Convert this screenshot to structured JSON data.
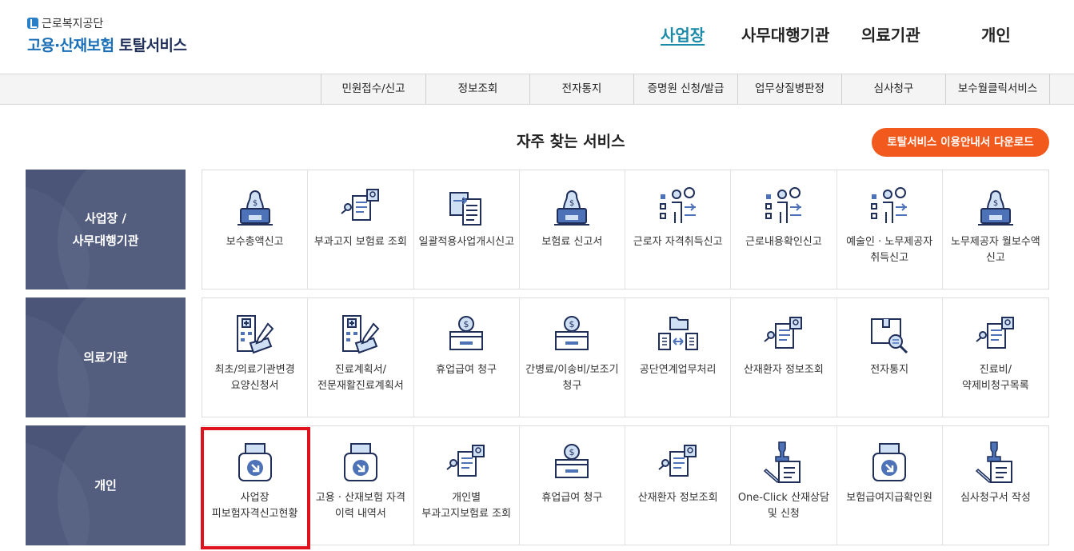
{
  "logo": {
    "org": "근로복지공단",
    "main_a": "고용·산재보험",
    "main_b": "토탈서비스"
  },
  "top_nav": [
    {
      "label": "사업장",
      "active": true
    },
    {
      "label": "사무대행기관",
      "active": false
    },
    {
      "label": "의료기관",
      "active": false
    },
    {
      "label": "개인",
      "active": false
    }
  ],
  "sub_nav": [
    "민원접수/신고",
    "정보조회",
    "전자통지",
    "증명원 신청/발급",
    "업무상질병판정",
    "심사청구",
    "보수월클릭서비스"
  ],
  "section": {
    "title": "자주 찾는 서비스",
    "download_label": "토탈서비스 이용안내서 다운로드"
  },
  "colors": {
    "accent": "#1a8aa8",
    "brand": "#1a6fb8",
    "category_bg": "#4a5578",
    "download_btn": "#f25a1d",
    "highlight": "#e0121d"
  },
  "rows": [
    {
      "category": "사업장 /\n사무대행기관",
      "tiles": [
        {
          "label": "보수총액신고",
          "icon": "money-laptop-icon"
        },
        {
          "label": "부과고지 보험료 조회",
          "icon": "document-search-icon"
        },
        {
          "label": "일괄적용사업개시신고",
          "icon": "document-transfer-icon"
        },
        {
          "label": "보험료 신고서",
          "icon": "money-laptop-icon"
        },
        {
          "label": "근로자 자격취득신고",
          "icon": "person-checklist-icon"
        },
        {
          "label": "근로내용확인신고",
          "icon": "person-checklist-icon"
        },
        {
          "label": "예술인 · 노무제공자 취득신고",
          "icon": "person-checklist-icon"
        },
        {
          "label": "노무제공자 월보수액 신고",
          "icon": "money-laptop-icon"
        }
      ]
    },
    {
      "category": "의료기관",
      "tiles": [
        {
          "label": "최초/의료기관변경 요양신청서",
          "icon": "hospital-document-icon"
        },
        {
          "label": "진료계획서/전문재활진료계획서",
          "icon": "hospital-document-icon"
        },
        {
          "label": "휴업급여 청구",
          "icon": "money-box-icon"
        },
        {
          "label": "간병료/이송비/보조기 청구",
          "icon": "money-box-icon"
        },
        {
          "label": "공단연계업무처리",
          "icon": "folder-exchange-icon"
        },
        {
          "label": "산재환자 정보조회",
          "icon": "document-search-icon"
        },
        {
          "label": "전자통지",
          "icon": "box-search-icon"
        },
        {
          "label": "진료비/약제비청구목록",
          "icon": "document-search-icon"
        }
      ]
    },
    {
      "category": "개인",
      "tiles": [
        {
          "label": "사업장 피보험자격신고현황",
          "icon": "printer-download-icon"
        },
        {
          "label": "고용 · 산재보험 자격 이력 내역서",
          "icon": "printer-download-icon"
        },
        {
          "label": "개인별 부과고지보험료 조회",
          "icon": "document-search-icon"
        },
        {
          "label": "휴업급여 청구",
          "icon": "money-box-icon"
        },
        {
          "label": "산재환자 정보조회",
          "icon": "document-search-icon"
        },
        {
          "label": "One-Click 산재상담 및 신청",
          "icon": "stamp-document-icon"
        },
        {
          "label": "보험급여지급확인원",
          "icon": "printer-download-icon"
        },
        {
          "label": "심사청구서 작성",
          "icon": "stamp-document-icon"
        }
      ]
    }
  ]
}
